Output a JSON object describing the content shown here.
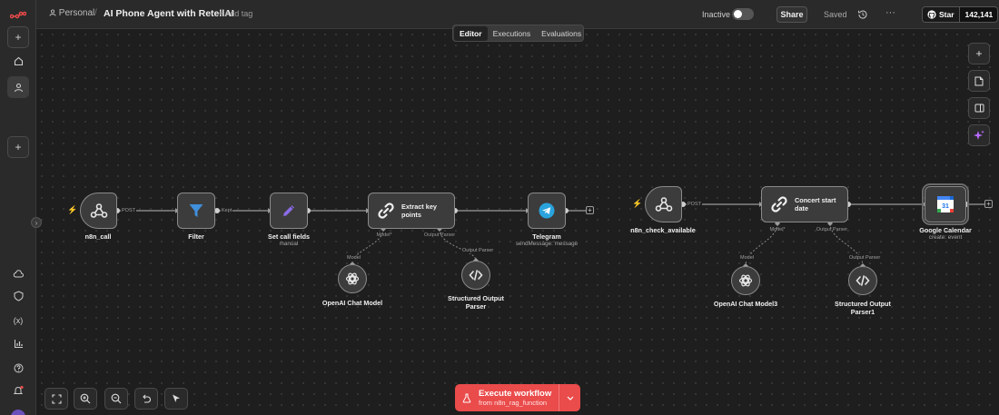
{
  "app": {
    "brand_icon": "n8n-logo-icon",
    "accent": "#ea4b4b"
  },
  "header": {
    "project": "Personal",
    "separator": "/",
    "workflow_title": "AI Phone Agent with RetellAI",
    "add_tag": "+ Add tag",
    "status_label": "Inactive",
    "share_label": "Share",
    "saved_label": "Saved",
    "more_label": "···",
    "github_label": "Star",
    "github_count": "142,141"
  },
  "tabs": [
    {
      "label": "Editor",
      "active": true
    },
    {
      "label": "Executions",
      "active": false
    },
    {
      "label": "Evaluations",
      "active": false
    }
  ],
  "sidebar": {
    "top_items": [
      "add-icon",
      "home-icon",
      "user-icon",
      "add-icon"
    ],
    "bottom_items": [
      "cloud-icon",
      "shield-icon",
      "variables-icon",
      "chart-icon",
      "help-icon",
      "bell-icon"
    ],
    "variables_glyph": "(x)"
  },
  "workflow1": {
    "trigger": {
      "label": "n8n_call",
      "edge": "POST"
    },
    "filter": {
      "label": "Filter",
      "edge": "Kept"
    },
    "set": {
      "label": "Set call fields",
      "sub": "manual"
    },
    "chain": {
      "label_line1": "Extract key",
      "label_line2": "points",
      "model_port": "Model*",
      "parser_port": "Output Parser"
    },
    "telegram": {
      "label": "Telegram",
      "sub": "sendMessage: message"
    },
    "model": {
      "edge": "Model",
      "label": "OpenAI Chat Model"
    },
    "parser": {
      "edge": "Output Parser",
      "label_line1": "Structured Output",
      "label_line2": "Parser"
    }
  },
  "workflow2": {
    "trigger": {
      "label": "n8n_check_available",
      "edge": "POST"
    },
    "chain": {
      "label_line1": "Concert start",
      "label_line2": "date",
      "model_port": "Model*",
      "parser_port": "Output Parser"
    },
    "calendar": {
      "label": "Google Calendar",
      "sub": "create: event"
    },
    "model": {
      "edge": "Model",
      "label": "OpenAI Chat Model3"
    },
    "parser": {
      "edge": "Output Parser",
      "label_line1": "Structured Output",
      "label_line2": "Parser1"
    }
  },
  "execute": {
    "title": "Execute workflow",
    "subtitle": "from n8n_rag_function"
  }
}
